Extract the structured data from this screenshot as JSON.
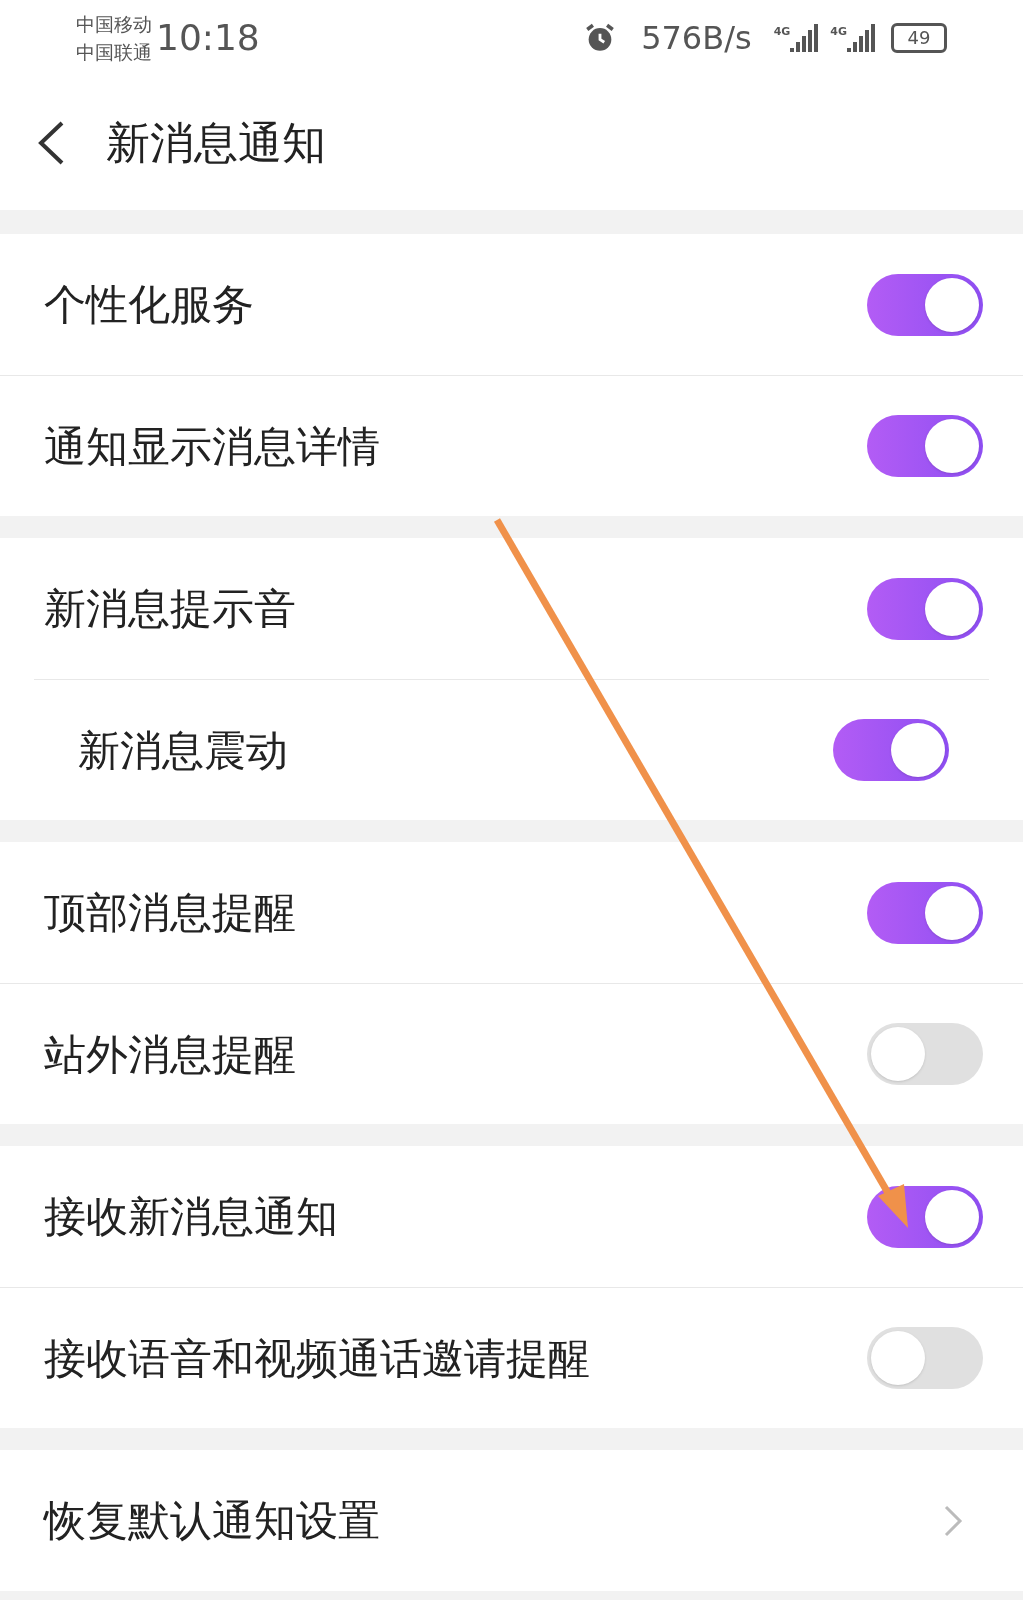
{
  "status_bar": {
    "carriers": [
      "中国移动",
      "中国联通"
    ],
    "time": "10:18",
    "net_speed": "576B/s",
    "signal_labels": [
      "4G",
      "4G"
    ],
    "battery": "49"
  },
  "header": {
    "title": "新消息通知"
  },
  "groups": [
    {
      "items": [
        {
          "kind": "toggle",
          "label": "个性化服务",
          "on": true
        },
        {
          "kind": "toggle",
          "label": "通知显示消息详情",
          "on": true
        }
      ]
    },
    {
      "items": [
        {
          "kind": "toggle",
          "label": "新消息提示音",
          "on": true
        },
        {
          "kind": "toggle",
          "label": "新消息震动",
          "on": true
        }
      ]
    },
    {
      "items": [
        {
          "kind": "toggle",
          "label": "顶部消息提醒",
          "on": true
        },
        {
          "kind": "toggle",
          "label": "站外消息提醒",
          "on": false
        }
      ]
    },
    {
      "items": [
        {
          "kind": "toggle",
          "label": "接收新消息通知",
          "on": true
        },
        {
          "kind": "toggle",
          "label": "接收语音和视频通话邀请提醒",
          "on": false
        }
      ]
    },
    {
      "items": [
        {
          "kind": "link",
          "label": "恢复默认通知设置"
        }
      ]
    }
  ]
}
